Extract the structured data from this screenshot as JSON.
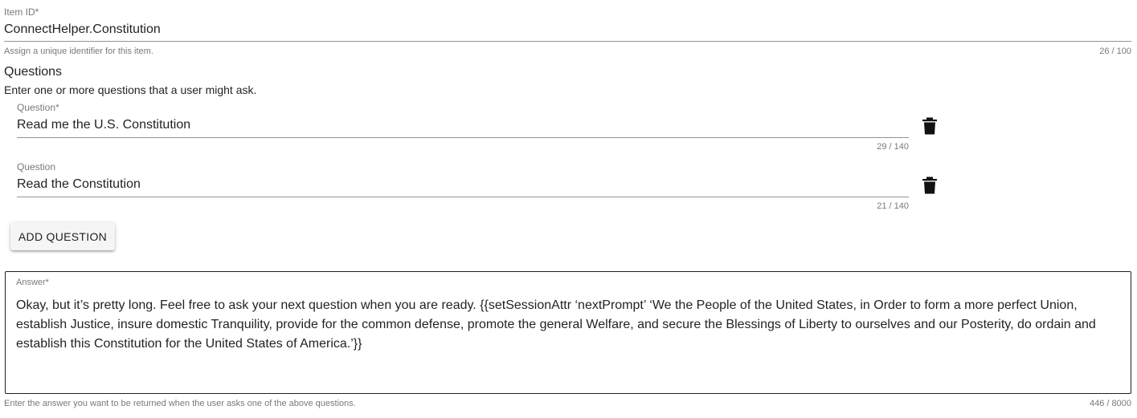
{
  "item_id": {
    "label": "Item ID*",
    "value": "ConnectHelper.Constitution",
    "helper": "Assign a unique identifier for this item.",
    "counter": "26 / 100"
  },
  "questions": {
    "title": "Questions",
    "description": "Enter one or more questions that a user might ask.",
    "items": [
      {
        "label": "Question*",
        "value": "Read me the U.S. Constitution",
        "counter": "29 / 140",
        "delete_icon": "trash-icon"
      },
      {
        "label": "Question",
        "value": "Read the Constitution",
        "counter": "21 / 140",
        "delete_icon": "trash-icon"
      }
    ],
    "add_button_label": "ADD QUESTION"
  },
  "answer": {
    "label": "Answer*",
    "value": "Okay, but it’s pretty long.  Feel free to ask your next question when you are ready. {{setSessionAttr ‘nextPrompt’ ‘We the People of the United States, in Order to form a more perfect Union, establish Justice, insure domestic Tranquility, provide for the common defense, promote the general Welfare, and secure the Blessings of Liberty to ourselves and our Posterity, do ordain and establish this Constitution for the United States of America.’}}",
    "helper": "Enter the answer you want to be returned when the user asks one of the above questions.",
    "counter": "446 / 8000"
  }
}
